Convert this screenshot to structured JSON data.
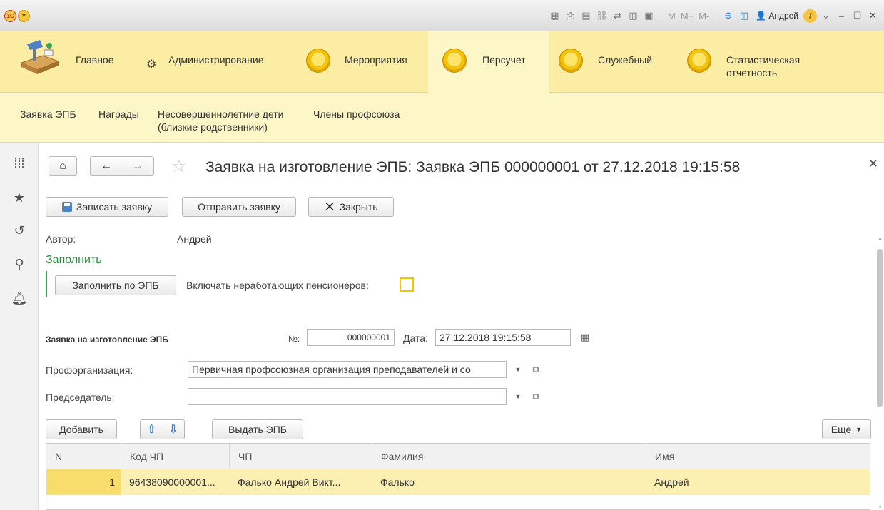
{
  "titlebar": {
    "logo_text": "1С",
    "user_name": "Андрей",
    "mem_labels": [
      "M",
      "M+",
      "M-"
    ]
  },
  "sections": [
    {
      "label": "Главное"
    },
    {
      "label": "Администрирование"
    },
    {
      "label": "Мероприятия"
    },
    {
      "label": "Персучет"
    },
    {
      "label": "Служебный"
    },
    {
      "label": "Статистическая отчетность"
    }
  ],
  "subnav": [
    {
      "label": "Заявка ЭПБ"
    },
    {
      "label": "Награды"
    },
    {
      "label": "Несовершеннолетние дети (близкие родственники)"
    },
    {
      "label": "Члены профсоюза"
    }
  ],
  "form": {
    "title": "Заявка на изготовление ЭПБ: Заявка ЭПБ 000000001 от 27.12.2018 19:15:58",
    "toolbar": {
      "save_label": "Записать заявку",
      "send_label": "Отправить заявку",
      "close_label": "Закрыть"
    },
    "author_label": "Автор:",
    "author_value": "Андрей",
    "fill_group_title": "Заполнить",
    "fill_button_label": "Заполнить по ЭПБ",
    "include_pensioners_label": "Включать неработающих пенсионеров:",
    "include_pensioners_checked": false,
    "doc_caption": "Заявка на изготовление ЭПБ",
    "number_label": "№:",
    "number_value": "000000001",
    "date_label": "Дата:",
    "date_value": "27.12.2018 19:15:58",
    "org_label": "Профорганизация:",
    "org_value": "Первичная профсоюзная организация преподавателей и со",
    "chairman_label": "Председатель:",
    "chairman_value": "",
    "table_toolbar": {
      "add_label": "Добавить",
      "issue_label": "Выдать ЭПБ",
      "more_label": "Еще"
    },
    "table": {
      "columns": [
        "N",
        "Код ЧП",
        "ЧП",
        "Фамилия",
        "Имя"
      ],
      "rows": [
        {
          "n": "1",
          "code": "96438090000001...",
          "member": "Фалько Андрей Викт...",
          "last_name": "Фалько",
          "first_name": "Андрей"
        }
      ]
    }
  },
  "colors": {
    "sections_bg": "#fbeea4",
    "subnav_bg": "#fdf6c6",
    "accent_green": "#2e8b3d",
    "selected_row": "#fbf0b2"
  }
}
